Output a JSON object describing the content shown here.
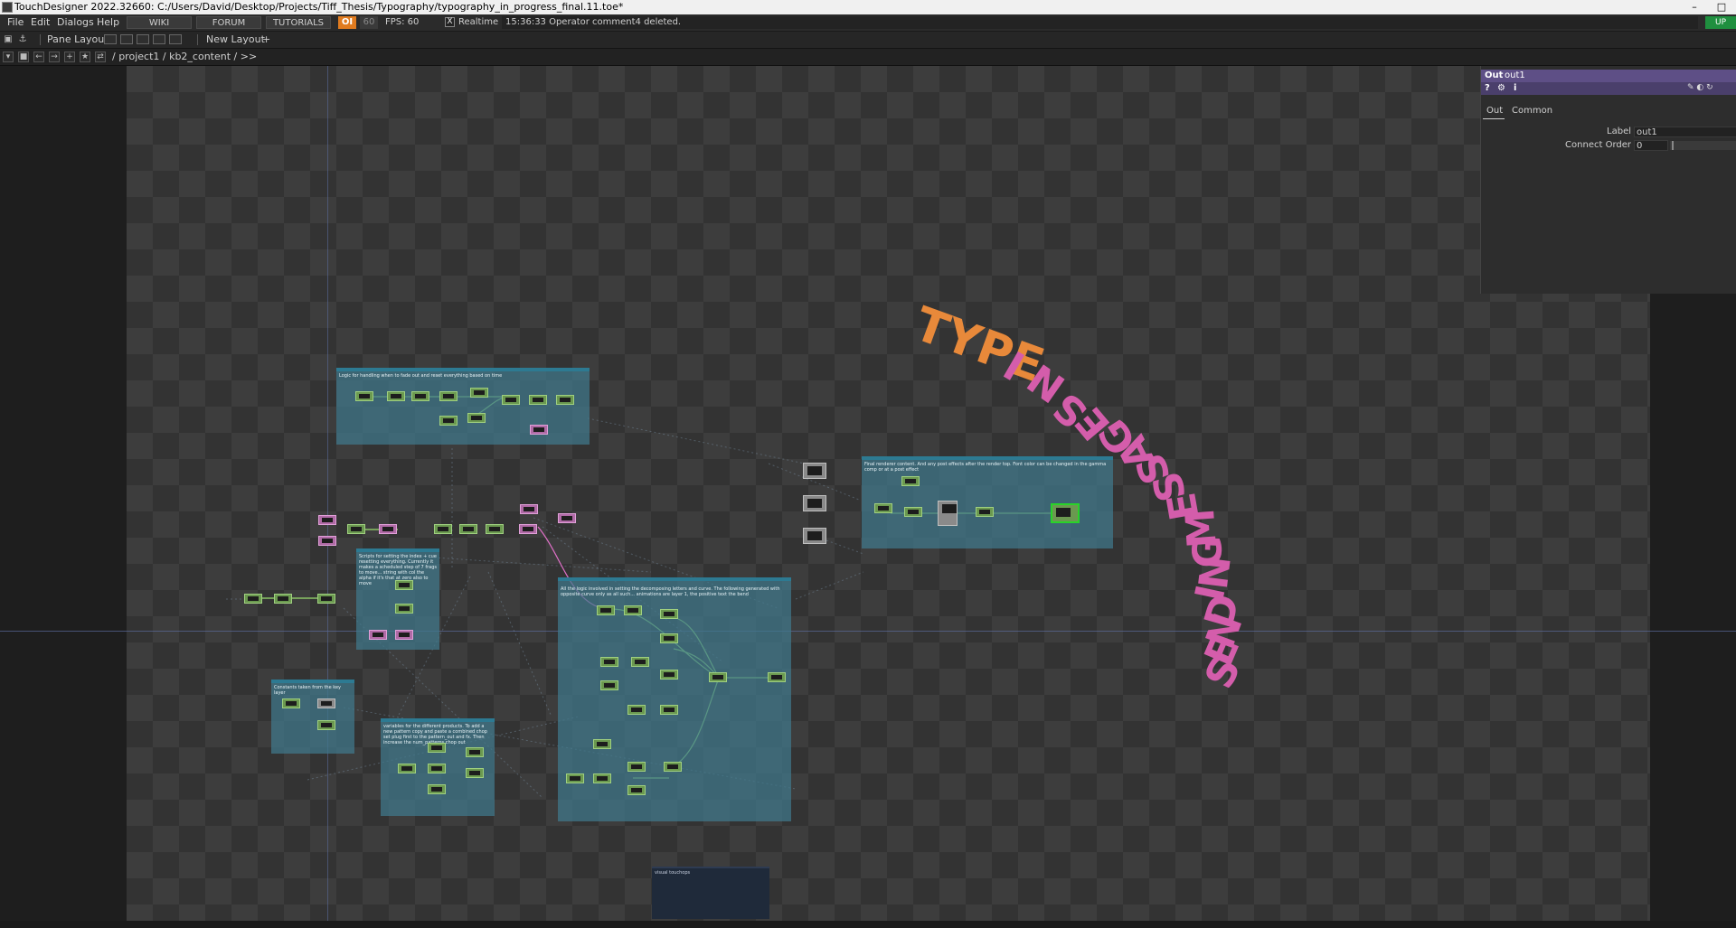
{
  "window": {
    "title": "TouchDesigner 2022.32660: C:/Users/David/Desktop/Projects/Tiff_Thesis/Typography/typography_in_progress_final.11.toe*",
    "min_glyph": "–",
    "max_glyph": "□"
  },
  "menubar": {
    "items": [
      "File",
      "Edit",
      "Dialogs",
      "Help"
    ],
    "buttons": [
      "WIKI",
      "FORUM",
      "TUTORIALS"
    ],
    "oi_label": "OI",
    "fps_small": "60",
    "fps_label": "FPS: 60",
    "realtime_check": "X",
    "realtime_label": "Realtime",
    "status_text": "15:36:33 Operator comment4 deleted.",
    "update_label": "UP"
  },
  "panebar": {
    "pane_layout_label": "Pane Layout",
    "new_layout_label": "New Layout",
    "add_glyph": "+"
  },
  "pathbar": {
    "path": "/ project1 / kb2_content / >>"
  },
  "comments": {
    "logic": "Logic for handling when to fade out and reset everything based on time",
    "scripts": "Scripts for setting the index + cue resetting everything. Currently it makes a scheduled step of 7 frags to move... string with col the alpha if it's that at zero also to move",
    "main": "All the logic involved in setting the decomposing letters and curve. The following generated with opposite curve only as all such... animations are layer 1, the positive text the bend",
    "constants": "Constants taken from the key layer",
    "variables": "variables for the different products. To add a new pattern copy and paste a combined chop set plug first to the pattern_out and fx. Then increase the num_patterns chop out",
    "render": "Final renderer content. And any post effects after the render top. Font color can be changed in the gamma comp or at a post effect",
    "visual": "visual touchops"
  },
  "typography": {
    "orange_text": "TYPE",
    "pink_chars": [
      "I",
      "N",
      "S",
      "E",
      "G",
      "A",
      "S",
      "S",
      "E",
      "M",
      "G",
      "N",
      "I",
      "D",
      "N",
      "E",
      "S"
    ]
  },
  "params": {
    "op_type": "Out",
    "op_name": "out1",
    "tool_icons": [
      "?",
      "⚙",
      "i"
    ],
    "tool_right": "✎ ◐ ↻",
    "tabs": [
      "Out",
      "Common"
    ],
    "label_label": "Label",
    "label_value": "out1",
    "connect_order_label": "Connect Order",
    "connect_order_value": "0"
  },
  "colors": {
    "type_pink": "#d45dab",
    "type_orange": "#e8893a",
    "param_header": "#5e4f86",
    "oi_orange": "#e07b1f",
    "comment_teal": "#40788c"
  }
}
